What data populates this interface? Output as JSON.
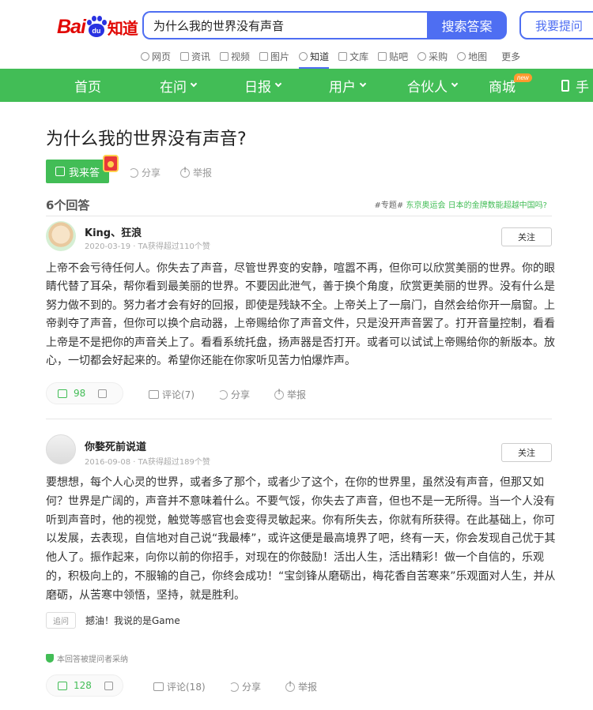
{
  "header": {
    "logo_bai": "Bai",
    "logo_du": "du",
    "logo_zhidao": "知道",
    "search_value": "为什么我的世界没有声音",
    "search_button": "搜索答案",
    "ask_button": "我要提问"
  },
  "subnav": [
    {
      "label": "网页",
      "icon": "search-icon"
    },
    {
      "label": "资讯",
      "icon": "news-icon"
    },
    {
      "label": "视频",
      "icon": "video-icon"
    },
    {
      "label": "图片",
      "icon": "image-icon"
    },
    {
      "label": "知道",
      "icon": "question-icon",
      "active": true
    },
    {
      "label": "文库",
      "icon": "doc-icon"
    },
    {
      "label": "贴吧",
      "icon": "tieba-icon"
    },
    {
      "label": "采购",
      "icon": "purchase-icon"
    },
    {
      "label": "地图",
      "icon": "map-icon"
    },
    {
      "label": "更多"
    }
  ],
  "greennav": {
    "home": "首页",
    "zaiwen": "在问",
    "ribao": "日报",
    "users": "用户",
    "partners": "合伙人",
    "mall": "商城",
    "new_badge": "new",
    "phone": "手"
  },
  "question": {
    "title": "为什么我的世界没有声音?",
    "answer_button": "我来答",
    "share": "分享",
    "report": "举报"
  },
  "answers_count": "6个回答",
  "topic": {
    "prefix": "#专题#",
    "text": "东京奥运会 日本的金牌数能超越中国吗?"
  },
  "answers": [
    {
      "username": "King、狂浪",
      "meta": "2020-03-19 · TA获得超过110个赞",
      "follow": "关注",
      "text": "上帝不会亏待任何人。你失去了声音，尽管世界变的安静，喧嚣不再，但你可以欣赏美丽的世界。你的眼睛代替了耳朵，帮你看到最美丽的世界。不要因此泄气，善于换个角度，欣赏更美丽的世界。没有什么是努力做不到的。努力者才会有好的回报，即使是残缺不全。上帝关上了一扇门，自然会给你开一扇窗。上帝剥夺了声音，但你可以换个启动器，上帝赐给你了声音文件，只是没开声音罢了。打开音量控制，看看上帝是不是把你的声音关上了。看看系统托盘，扬声器是否打开。或者可以试试上帝赐给你的新版本。放心，一切都会好起来的。希望你还能在你家听见苦力怕爆炸声。",
      "likes": "98",
      "comments": "评论(7)",
      "share": "分享",
      "report": "举报"
    },
    {
      "username": "你婺死前说道",
      "meta": "2016-09-08 · TA获得超过189个赞",
      "follow": "关注",
      "text": "要想想，每个人心灵的世界，或者多了那个，或者少了这个，在你的世界里，虽然没有声音，但那又如何？世界是广阔的，声音并不意味着什么。不要气馁，你失去了声音，但也不是一无所得。当一个人没有听到声音时，他的视觉，触觉等感官也会变得灵敏起来。你有所失去，你就有所获得。在此基础上，你可以发展，去表现，自信地对自己说“我最棒”，或许这便是最高境界了吧，终有一天，你会发现自己优于其他人了。振作起来，向你以前的你招手，对现在的你鼓励！活出人生，活出精彩！做一个自信的，乐观的，积极向上的，不服输的自己，你终会成功！“宝剑锋从磨砺出，梅花香自苦寒来”乐观面对人生，并从磨砺，从苦寒中领悟，坚持，就是胜利。",
      "followup_tag": "追问",
      "followup_text": "撼油！我说的是Game",
      "adopted": "本回答被提问者采纳",
      "likes": "128",
      "comments": "评论(18)",
      "share": "分享",
      "report": "举报"
    }
  ],
  "colors": {
    "green": "#42bd56",
    "blue": "#4e6ef2",
    "baidu_red": "#e10602"
  }
}
